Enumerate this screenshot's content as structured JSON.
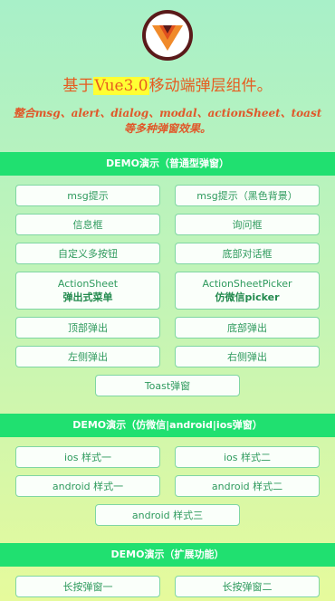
{
  "header": {
    "title_prefix": "基于",
    "title_highlight": "Vue3.0",
    "title_suffix": "移动端弹层组件。",
    "subtitle": "整合msg、alert、dialog、modal、actionSheet、toast等多种弹窗效果。"
  },
  "sections": [
    {
      "title": "DEMO演示（普通型弹窗）",
      "buttons": [
        "msg提示",
        "msg提示（黑色背景）",
        "信息框",
        "询问框",
        "自定义多按钮",
        "底部对话框"
      ],
      "action_sheet": {
        "line1": "ActionSheet",
        "line2": "弹出式菜单"
      },
      "action_sheet_picker": {
        "line1": "ActionSheetPicker",
        "line2": "仿微信picker"
      },
      "buttons2": [
        "顶部弹出",
        "底部弹出",
        "左侧弹出",
        "右侧弹出"
      ],
      "single": "Toast弹窗"
    },
    {
      "title": "DEMO演示（仿微信|android|ios弹窗）",
      "buttons": [
        "ios 样式一",
        "ios 样式二",
        "android 样式一",
        "android 样式二"
      ],
      "single": "android 样式三"
    },
    {
      "title": "DEMO演示（扩展功能）",
      "buttons": [
        "长按弹窗一",
        "长按弹窗二"
      ]
    }
  ],
  "colors": {
    "accent": "#20e070",
    "title": "#e65c1f",
    "button_text": "#2e9a5d"
  }
}
